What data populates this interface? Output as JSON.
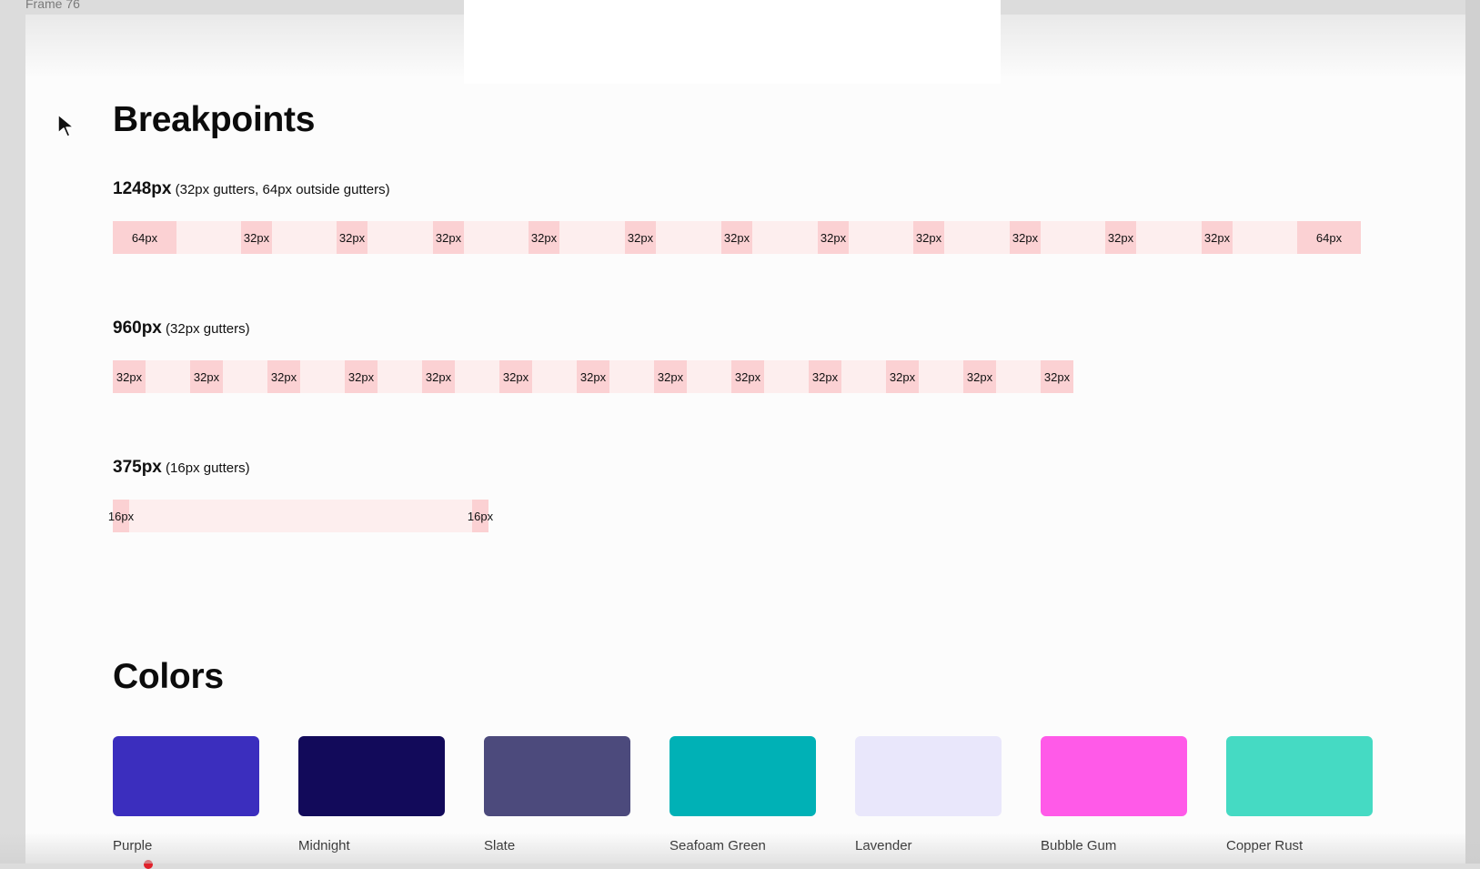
{
  "frame": {
    "label": "Frame 76"
  },
  "breakpoints": {
    "title": "Breakpoints",
    "items": [
      {
        "size": "1248px",
        "note": "(32px gutters, 64px outside gutters)",
        "gutter_labels": [
          "64px",
          "32px",
          "32px",
          "32px",
          "32px",
          "32px",
          "32px",
          "32px",
          "32px",
          "32px",
          "32px",
          "32px",
          "64px"
        ]
      },
      {
        "size": "960px",
        "note": "(32px gutters)",
        "gutter_labels": [
          "32px",
          "32px",
          "32px",
          "32px",
          "32px",
          "32px",
          "32px",
          "32px",
          "32px",
          "32px",
          "32px",
          "32px",
          "32px"
        ]
      },
      {
        "size": "375px",
        "note": "(16px gutters)",
        "gutter_labels": [
          "16px",
          "16px"
        ]
      }
    ]
  },
  "colors": {
    "title": "Colors",
    "swatches": [
      {
        "name": "Purple",
        "hex": "#3b2ebe"
      },
      {
        "name": "Midnight",
        "hex": "#120a5a"
      },
      {
        "name": "Slate",
        "hex": "#4c4a7c"
      },
      {
        "name": "Seafoam Green",
        "hex": "#00b1b6"
      },
      {
        "name": "Lavender",
        "hex": "#e9e7fb"
      },
      {
        "name": "Bubble Gum",
        "hex": "#ff5ae8"
      },
      {
        "name": "Copper Rust",
        "hex": "#45dac3"
      }
    ]
  },
  "theme": {
    "gutter_color": "#fbd1d3",
    "column_color": "#fdeeee",
    "canvas_color": "#fcfcfc",
    "indicator_dot": "#e0202a"
  }
}
